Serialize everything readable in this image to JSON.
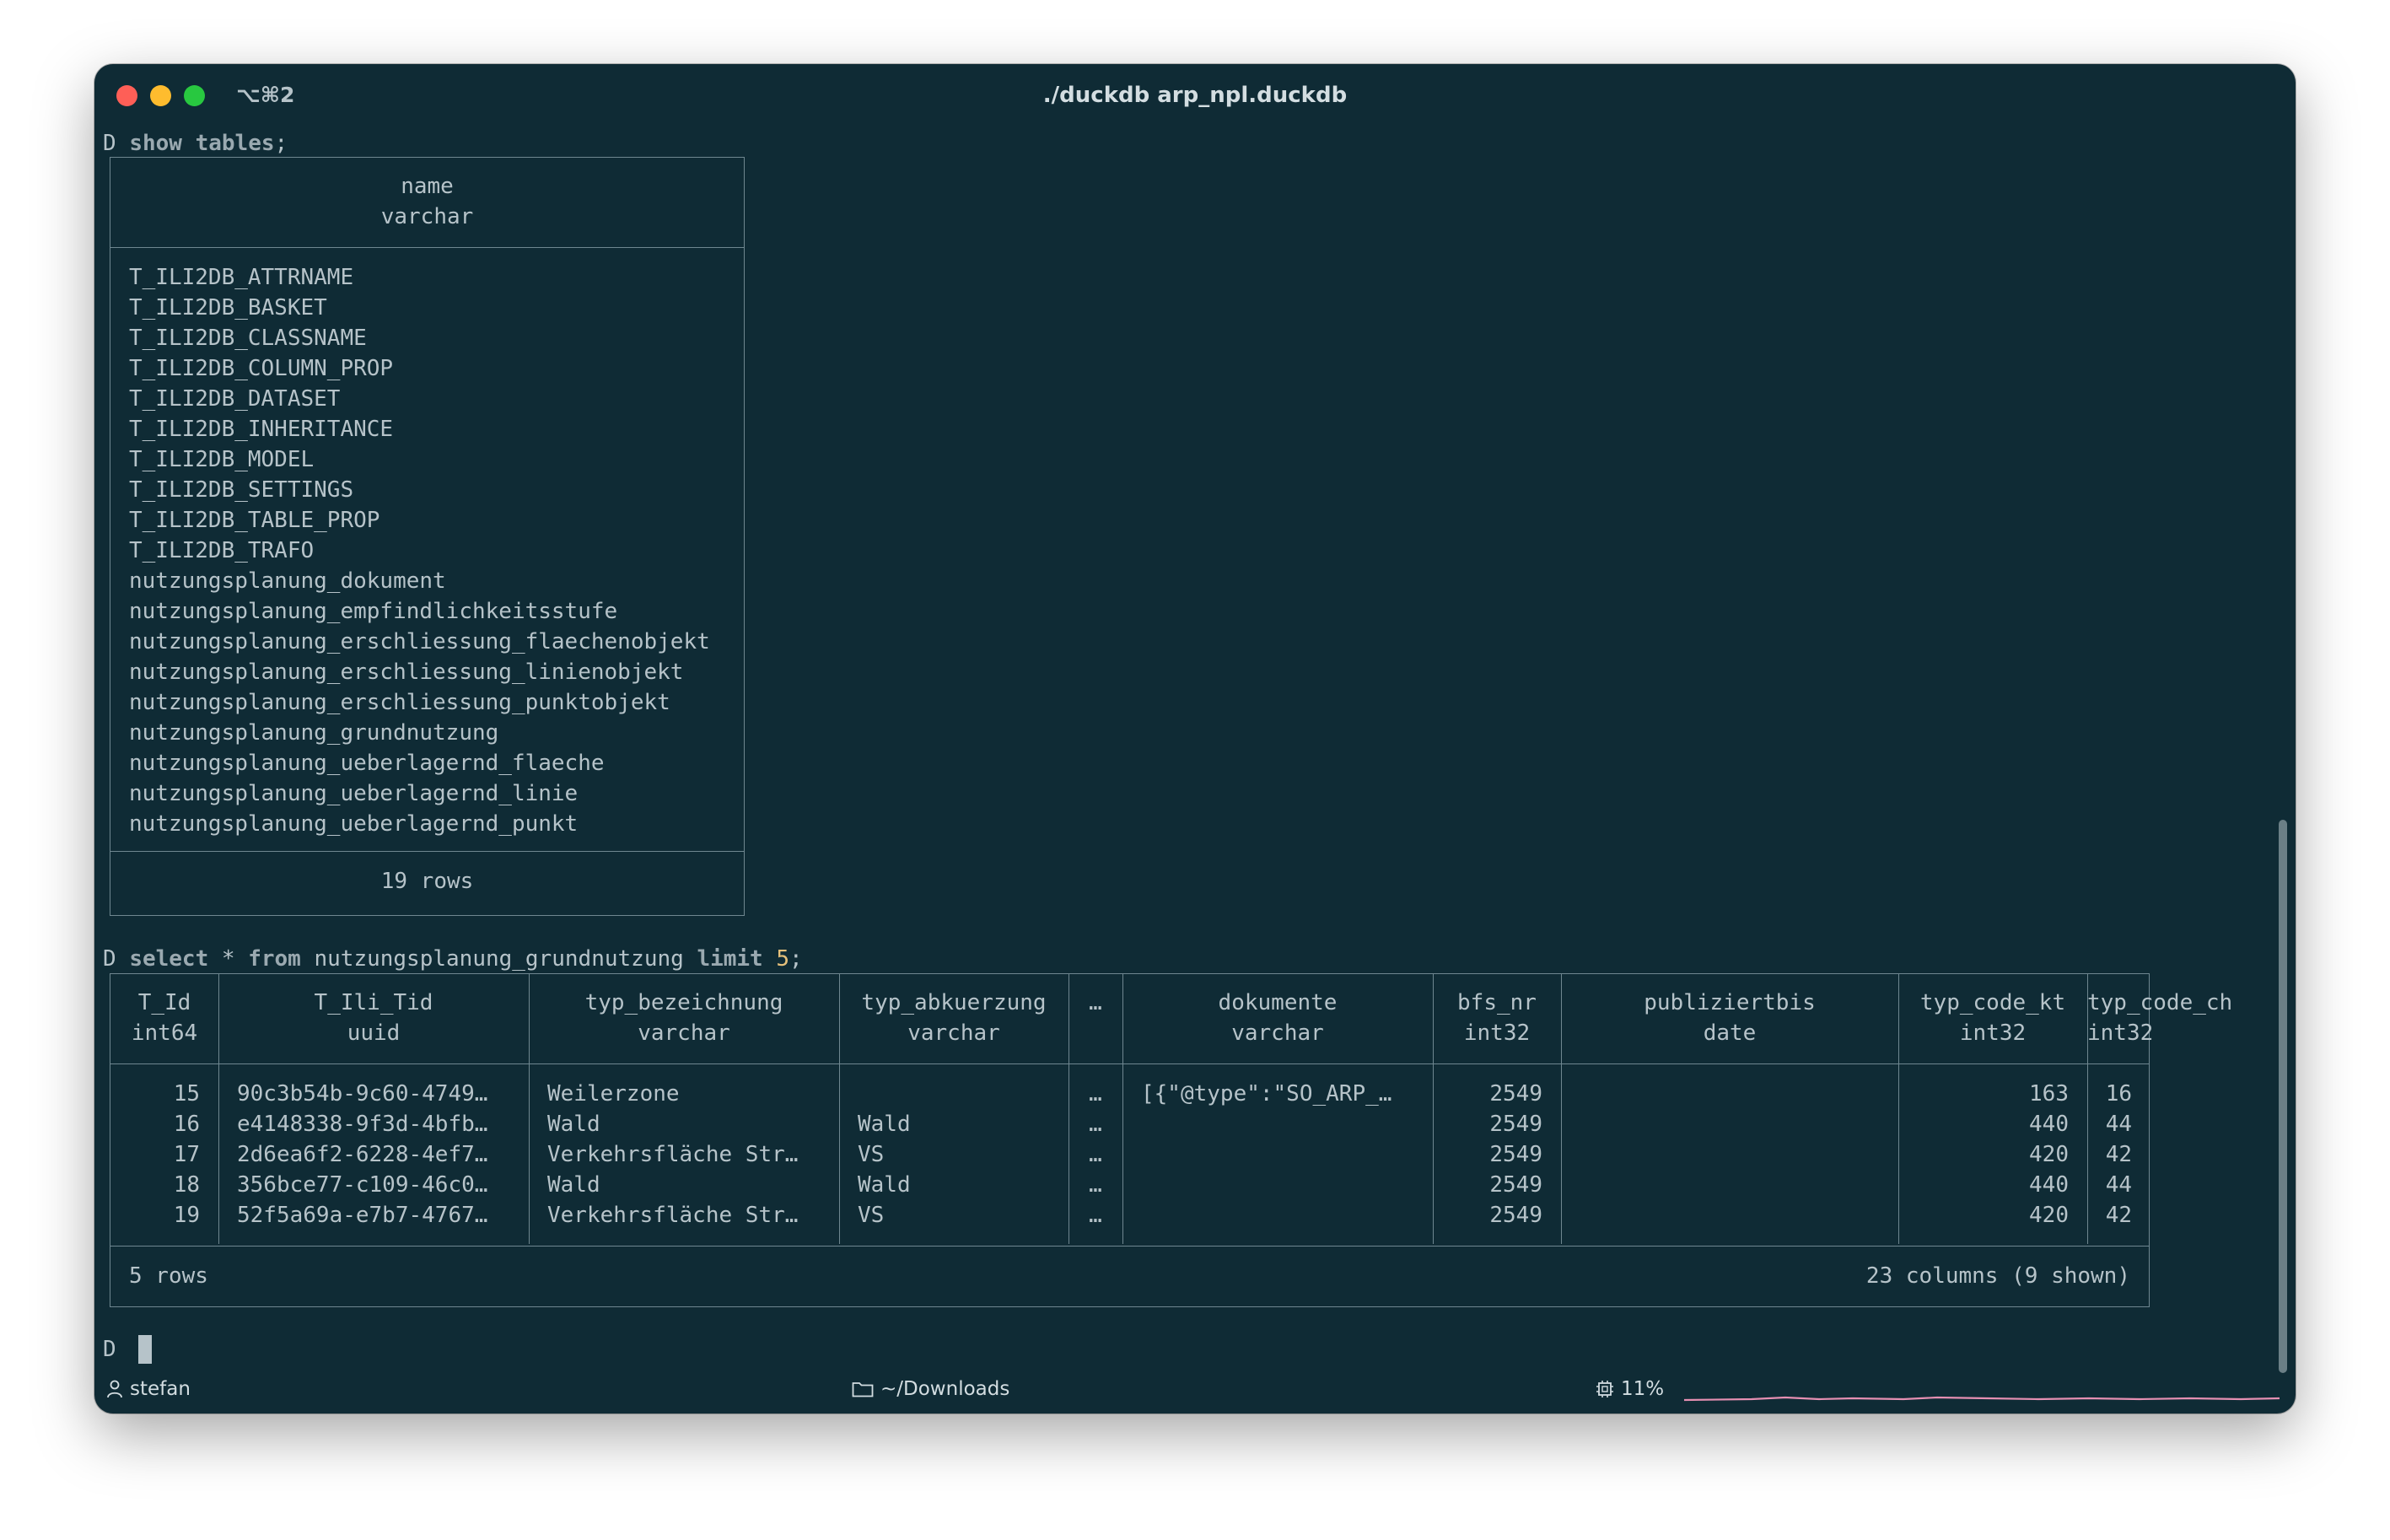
{
  "window": {
    "shortcut": "⌥⌘2",
    "title": "./duckdb arp_npl.duckdb"
  },
  "session": {
    "prompt": "D",
    "commands": [
      {
        "kw1": "show",
        "kw2": "tables",
        "end": ";"
      },
      {
        "kw1": "select",
        "rest1": " * ",
        "kw2": "from",
        "rest2": " nutzungsplanung_grundnutzung ",
        "kw3": "limit",
        "num": "5",
        "end": ";"
      }
    ],
    "tables_result": {
      "header_name": "name",
      "header_type": "varchar",
      "rows": [
        "T_ILI2DB_ATTRNAME",
        "T_ILI2DB_BASKET",
        "T_ILI2DB_CLASSNAME",
        "T_ILI2DB_COLUMN_PROP",
        "T_ILI2DB_DATASET",
        "T_ILI2DB_INHERITANCE",
        "T_ILI2DB_MODEL",
        "T_ILI2DB_SETTINGS",
        "T_ILI2DB_TABLE_PROP",
        "T_ILI2DB_TRAFO",
        "nutzungsplanung_dokument",
        "nutzungsplanung_empfindlichkeitsstufe",
        "nutzungsplanung_erschliessung_flaechenobjekt",
        "nutzungsplanung_erschliessung_linienobjekt",
        "nutzungsplanung_erschliessung_punktobjekt",
        "nutzungsplanung_grundnutzung",
        "nutzungsplanung_ueberlagernd_flaeche",
        "nutzungsplanung_ueberlagernd_linie",
        "nutzungsplanung_ueberlagernd_punkt"
      ],
      "footer": "19 rows"
    },
    "select_result": {
      "columns": [
        {
          "name": "T_Id",
          "type": "int64"
        },
        {
          "name": "T_Ili_Tid",
          "type": "uuid"
        },
        {
          "name": "typ_bezeichnung",
          "type": "varchar"
        },
        {
          "name": "typ_abkuerzung",
          "type": "varchar"
        },
        {
          "name": "…",
          "type": ""
        },
        {
          "name": "dokumente",
          "type": "varchar"
        },
        {
          "name": "bfs_nr",
          "type": "int32"
        },
        {
          "name": "publiziertbis",
          "type": "date"
        },
        {
          "name": "typ_code_kt",
          "type": "int32"
        },
        {
          "name": "typ_code_ch",
          "type": "int32"
        }
      ],
      "rows": [
        [
          "15",
          "90c3b54b-9c60-4749…",
          "Weilerzone",
          "",
          "…",
          "[{\"@type\":\"SO_ARP_…",
          "2549",
          "",
          "163",
          "16"
        ],
        [
          "16",
          "e4148338-9f3d-4bfb…",
          "Wald",
          "Wald",
          "…",
          "",
          "2549",
          "",
          "440",
          "44"
        ],
        [
          "17",
          "2d6ea6f2-6228-4ef7…",
          "Verkehrsfläche Str…",
          "VS",
          "…",
          "",
          "2549",
          "",
          "420",
          "42"
        ],
        [
          "18",
          "356bce77-c109-46c0…",
          "Wald",
          "Wald",
          "…",
          "",
          "2549",
          "",
          "440",
          "44"
        ],
        [
          "19",
          "52f5a69a-e7b7-4767…",
          "Verkehrsfläche Str…",
          "VS",
          "…",
          "",
          "2549",
          "",
          "420",
          "42"
        ]
      ],
      "footer_left": "5 rows",
      "footer_right": "23 columns (9 shown)"
    }
  },
  "statusbar": {
    "user": "stefan",
    "user_icon": "user-icon",
    "path": "~/Downloads",
    "folder_icon": "folder-icon",
    "cpu": "11%",
    "cpu_icon": "cpu-icon",
    "graph_color": "#e58fb2"
  }
}
